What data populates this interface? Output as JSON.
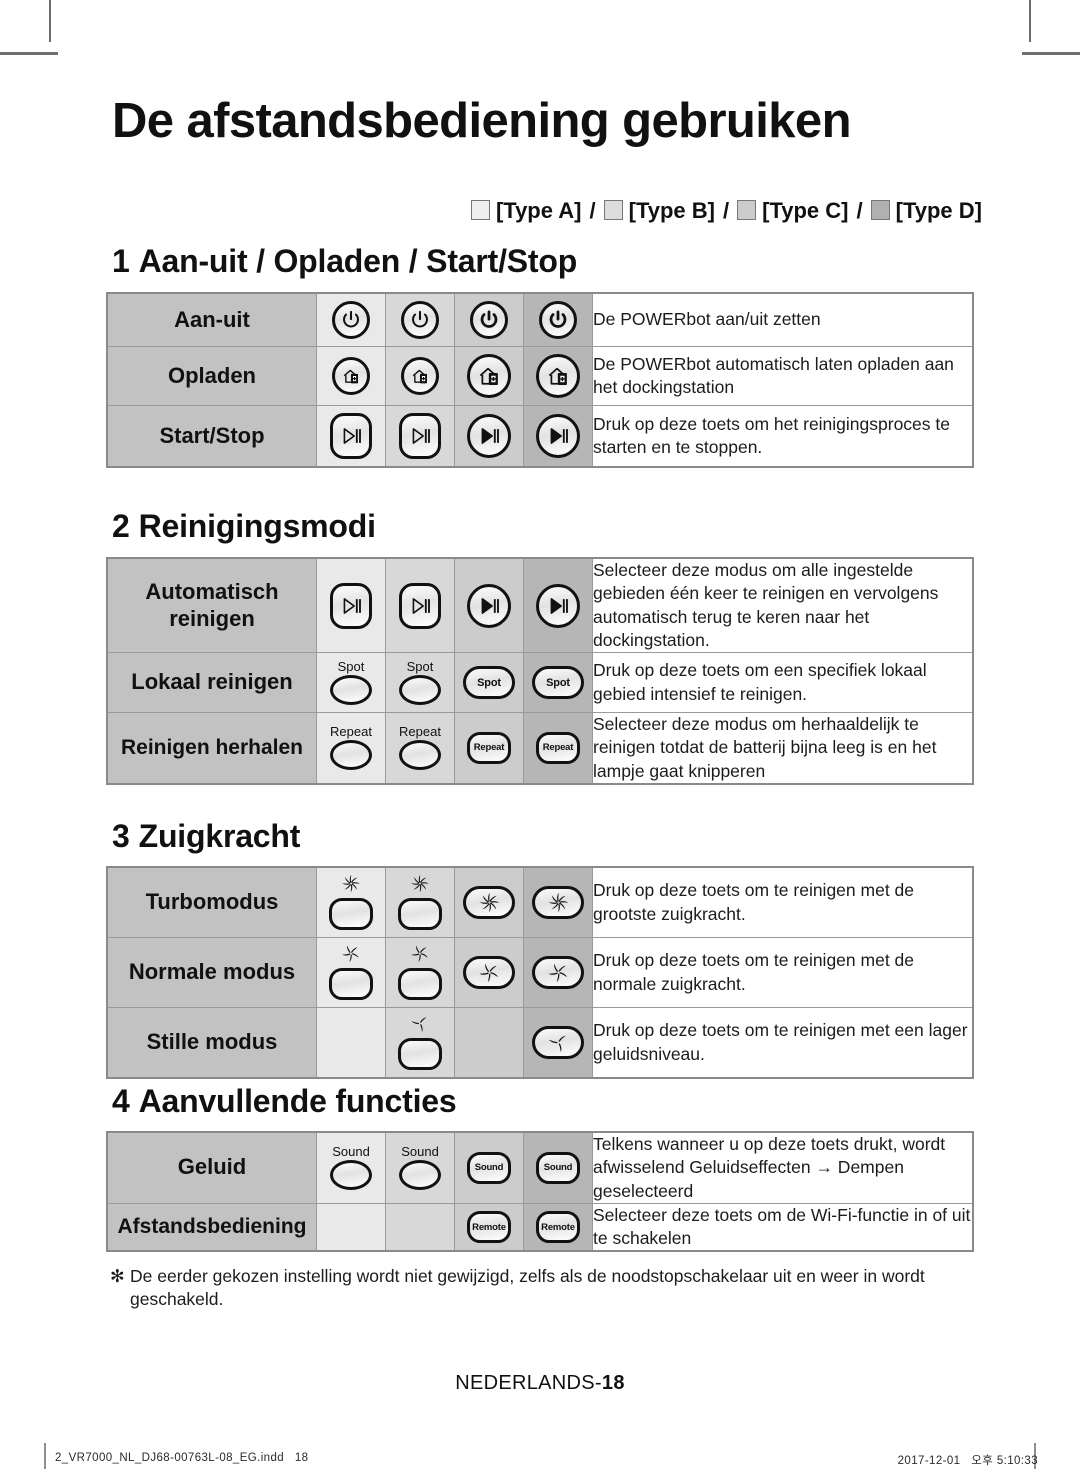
{
  "document": {
    "title": "De afstandsbediening gebruiken",
    "page_footer": "NEDERLANDS-",
    "page_number": "18",
    "footnote": "De eerder gekozen instelling wordt niet gewijzigd, zelfs als de noodstopschakelaar uit en weer in wordt geschakeld.",
    "footnote_marker": "✻"
  },
  "legend": {
    "type_a": "[Type A]",
    "type_b": "[Type B]",
    "type_c": "[Type C]",
    "type_d": "[Type D]",
    "separator": "/",
    "colors": {
      "type_a": "#e9e9e9",
      "type_b": "#d8d8d8",
      "type_c": "#cccccc",
      "type_d": "#b6b6b6",
      "label_column": "#c2c2c2",
      "border": "#8a8a8a"
    }
  },
  "sections": [
    {
      "number": "1",
      "heading": "Aan-uit / Opladen / Start/Stop",
      "rows": [
        {
          "label": "Aan-uit",
          "icon": "power-icon",
          "captions": [
            "",
            "",
            "",
            ""
          ],
          "description": "De POWERbot aan/uit zetten"
        },
        {
          "label": "Opladen",
          "icon": "home-charge-icon",
          "captions": [
            "",
            "",
            "",
            ""
          ],
          "description": "De POWERbot automatisch laten opladen aan het dockingstation"
        },
        {
          "label": "Start/Stop",
          "icon": "play-pause-icon",
          "captions": [
            "",
            "",
            "",
            ""
          ],
          "description": "Druk op deze toets om het reinigingsproces te starten en te stoppen."
        }
      ]
    },
    {
      "number": "2",
      "heading": "Reinigingsmodi",
      "rows": [
        {
          "label": "Automatisch reinigen",
          "icon": "play-pause-icon",
          "captions": [
            "",
            "",
            "",
            ""
          ],
          "description": "Selecteer deze modus om alle ingestelde gebieden één keer te reinigen en vervolgens automatisch terug te keren naar het dockingstation."
        },
        {
          "label": "Lokaal reinigen",
          "icon": "spot-button",
          "captions": [
            "Spot",
            "Spot",
            "Spot",
            "Spot"
          ],
          "description": "Druk op deze toets om een specifiek lokaal gebied intensief te reinigen."
        },
        {
          "label": "Reinigen herhalen",
          "icon": "repeat-button",
          "captions": [
            "Repeat",
            "Repeat",
            "Repeat",
            "Repeat"
          ],
          "description": "Selecteer deze modus om herhaaldelijk te reinigen totdat de batterij bijna leeg is en het lampje gaat knipperen"
        }
      ]
    },
    {
      "number": "3",
      "heading": "Zuigkracht",
      "rows": [
        {
          "label": "Turbomodus",
          "icon": "fan-turbo-icon",
          "captions": [
            "",
            "",
            "",
            ""
          ],
          "description": "Druk op deze toets om te reinigen met de grootste zuigkracht."
        },
        {
          "label": "Normale modus",
          "icon": "fan-normal-icon",
          "captions": [
            "",
            "",
            "",
            ""
          ],
          "description": "Druk op deze toets om te reinigen met de normale zuigkracht."
        },
        {
          "label": "Stille modus",
          "icon": "fan-silent-icon",
          "captions": [
            "",
            "",
            "",
            ""
          ],
          "description": "Druk op deze toets om te reinigen met een lager geluidsniveau."
        }
      ]
    },
    {
      "number": "4",
      "heading": "Aanvullende functies",
      "rows": [
        {
          "label": "Geluid",
          "icon": "sound-button",
          "captions": [
            "Sound",
            "Sound",
            "Sound",
            "Sound"
          ],
          "description": "Telkens wanneer u op deze toets drukt, wordt afwisselend Geluidseffecten → Dempen geselecteerd"
        },
        {
          "label": "Afstandsbediening",
          "icon": "remote-button",
          "captions": [
            "",
            "",
            "Remote",
            "Remote"
          ],
          "description": "Selecteer deze toets om de Wi-Fi-functie in of uit te schakelen"
        }
      ]
    }
  ],
  "print_runner": {
    "file": "2_VR7000_NL_DJ68-00763L-08_EG.indd",
    "page": "18",
    "date": "2017-12-01",
    "time": "오후 5:10:33"
  }
}
